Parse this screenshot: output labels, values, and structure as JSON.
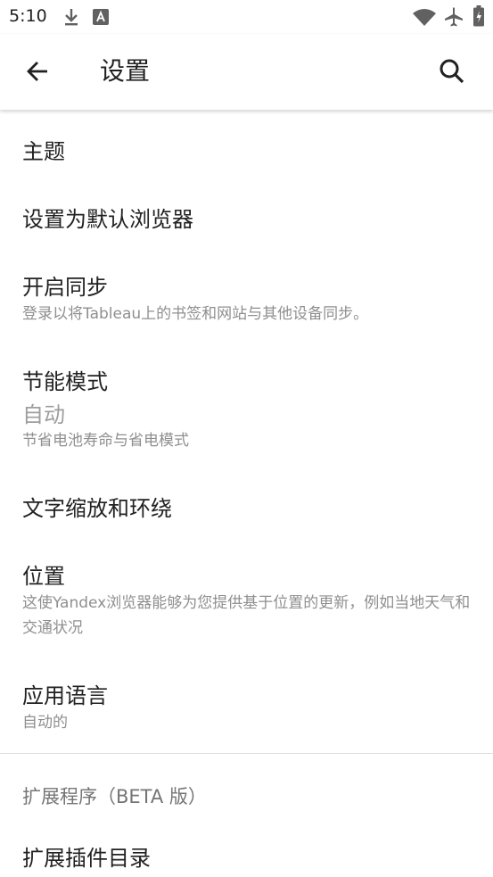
{
  "status_bar": {
    "time": "5:10",
    "left_icons": [
      "download-icon",
      "app-notification-icon"
    ],
    "right_icons": [
      "wifi-icon",
      "airplane-icon",
      "battery-icon"
    ]
  },
  "app_bar": {
    "title": "设置",
    "back_icon": "arrow-back-icon",
    "search_icon": "search-icon"
  },
  "settings": {
    "theme": {
      "title": "主题"
    },
    "default_browser": {
      "title": "设置为默认浏览器"
    },
    "sync": {
      "title": "开启同步",
      "summary": "登录以将Tableau上的书签和网站与其他设备同步。"
    },
    "power_saving": {
      "title": "节能模式",
      "value": "自动",
      "summary": "节省电池寿命与省电模式"
    },
    "text_scaling": {
      "title": "文字缩放和环绕"
    },
    "location": {
      "title": "位置",
      "summary": "这使Yandex浏览器能够为您提供基于位置的更新，例如当地天气和交通状况"
    },
    "app_language": {
      "title": "应用语言",
      "summary": "自动的"
    }
  },
  "extensions_section": {
    "header": "扩展程序（BETA 版）",
    "catalog": {
      "title": "扩展插件目录"
    }
  },
  "colors": {
    "text_primary": "#212121",
    "text_secondary": "#8f8f8f",
    "divider": "#e0e0e0",
    "background": "#ffffff"
  }
}
